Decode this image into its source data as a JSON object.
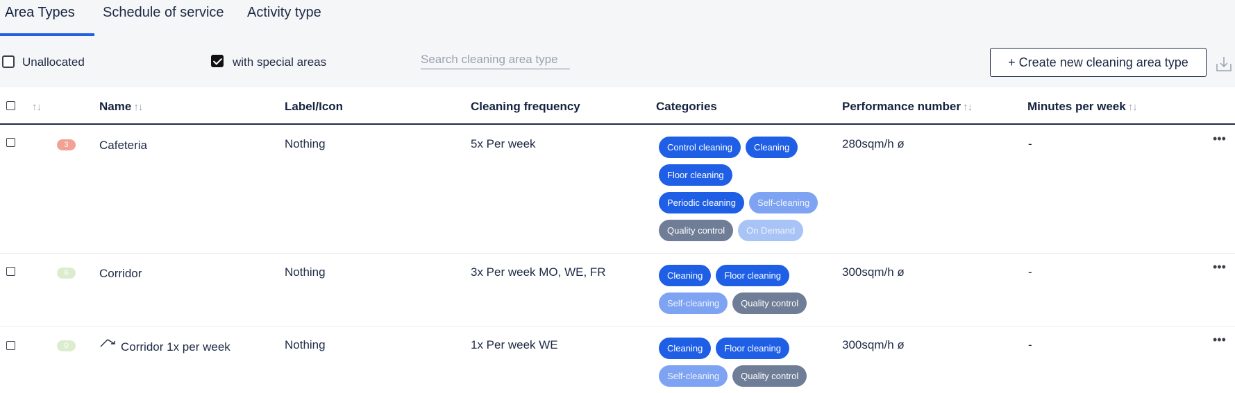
{
  "tabs": [
    {
      "label": "Area Types",
      "active": true
    },
    {
      "label": "Schedule of service",
      "active": false
    },
    {
      "label": "Activity type",
      "active": false
    }
  ],
  "toolbar": {
    "unallocated_label": "Unallocated",
    "unallocated_checked": false,
    "special_areas_label": "with special areas",
    "special_areas_checked": true,
    "search_placeholder": "Search cleaning area type",
    "search_value": "",
    "create_button_label": "+ Create new cleaning area type",
    "download_icon": "download-icon"
  },
  "table": {
    "headers": {
      "name": "Name",
      "label_icon": "Label/Icon",
      "frequency": "Cleaning frequency",
      "categories": "Categories",
      "performance": "Performance number",
      "minutes": "Minutes per week"
    },
    "sort_glyph": "↑↓",
    "rows": [
      {
        "count": "3",
        "count_color": "#f2a294",
        "name": "Cafeteria",
        "label_icon": "Nothing",
        "frequency": "5x Per week",
        "categories": [
          {
            "label": "Control cleaning",
            "style": "blue"
          },
          {
            "label": "Cleaning",
            "style": "blue"
          },
          {
            "label": "Floor cleaning",
            "style": "blue"
          },
          {
            "label": "Periodic cleaning",
            "style": "blue"
          },
          {
            "label": "Self-cleaning",
            "style": "light"
          },
          {
            "label": "Quality control",
            "style": "gray"
          },
          {
            "label": "On Demand",
            "style": "pale"
          }
        ],
        "performance": "280sqm/h ø",
        "minutes": "-",
        "actions": "•••"
      },
      {
        "count": "6",
        "count_color": "#dcedcf",
        "name": "Corridor",
        "label_icon": "Nothing",
        "frequency": "3x Per week MO, WE, FR",
        "categories": [
          {
            "label": "Cleaning",
            "style": "blue"
          },
          {
            "label": "Floor cleaning",
            "style": "blue"
          },
          {
            "label": "Self-cleaning",
            "style": "light"
          },
          {
            "label": "Quality control",
            "style": "gray"
          }
        ],
        "performance": "300sqm/h ø",
        "minutes": "-",
        "actions": "•••"
      },
      {
        "count": "0",
        "count_color": "#dcedcf",
        "name": "Corridor 1x per week",
        "name_icon": "shortcut-arrow-icon",
        "label_icon": "Nothing",
        "frequency": "1x Per week WE",
        "categories": [
          {
            "label": "Cleaning",
            "style": "blue"
          },
          {
            "label": "Floor cleaning",
            "style": "blue"
          },
          {
            "label": "Self-cleaning",
            "style": "light"
          },
          {
            "label": "Quality control",
            "style": "gray"
          }
        ],
        "performance": "300sqm/h ø",
        "minutes": "-",
        "actions": "•••"
      }
    ]
  },
  "colors": {
    "accent": "#1f5fe6",
    "text": "#1d2a44",
    "toolbar_bg": "#f5f6f8"
  }
}
